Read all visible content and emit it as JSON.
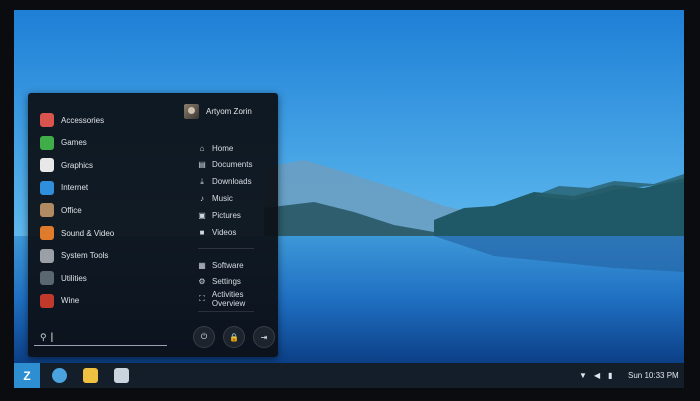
{
  "menu": {
    "categories": [
      {
        "label": "Accessories",
        "icon": "accessories-icon",
        "color": "#d9534f"
      },
      {
        "label": "Games",
        "icon": "games-icon",
        "color": "#3fae49"
      },
      {
        "label": "Graphics",
        "icon": "graphics-icon",
        "color": "#e8e8e8"
      },
      {
        "label": "Internet",
        "icon": "internet-icon",
        "color": "#2f8fdc"
      },
      {
        "label": "Office",
        "icon": "office-icon",
        "color": "#b08a62"
      },
      {
        "label": "Sound & Video",
        "icon": "sound-video-icon",
        "color": "#e07b2c"
      },
      {
        "label": "System Tools",
        "icon": "system-tools-icon",
        "color": "#9aa0a6"
      },
      {
        "label": "Utilities",
        "icon": "utilities-icon",
        "color": "#5b6770"
      },
      {
        "label": "Wine",
        "icon": "wine-icon",
        "color": "#c0392b"
      }
    ],
    "user": {
      "name": "Artyom Zorin"
    },
    "places": [
      {
        "label": "Home",
        "icon": "home-icon",
        "glyph": "⌂"
      },
      {
        "label": "Documents",
        "icon": "documents-icon",
        "glyph": "▤"
      },
      {
        "label": "Downloads",
        "icon": "downloads-icon",
        "glyph": "⤓"
      },
      {
        "label": "Music",
        "icon": "music-icon",
        "glyph": "♪"
      },
      {
        "label": "Pictures",
        "icon": "pictures-icon",
        "glyph": "▣"
      },
      {
        "label": "Videos",
        "icon": "videos-icon",
        "glyph": "■"
      }
    ],
    "system": [
      {
        "label": "Software",
        "icon": "software-icon",
        "glyph": "▦"
      },
      {
        "label": "Settings",
        "icon": "settings-icon",
        "glyph": "⚙"
      },
      {
        "label": "Activities Overview",
        "icon": "activities-icon",
        "glyph": "⛶"
      }
    ],
    "search": {
      "value": ""
    },
    "power_buttons": [
      {
        "name": "power-icon",
        "glyph": "⏻"
      },
      {
        "name": "lock-icon",
        "glyph": "🔒"
      },
      {
        "name": "logout-icon",
        "glyph": "⇥"
      }
    ]
  },
  "panel": {
    "launcher_icon": "zorin-logo-icon",
    "launcher_glyph": "Z",
    "taskbar": [
      {
        "name": "chromium-icon",
        "color": "#4aa3df"
      },
      {
        "name": "software-store-icon",
        "color": "#f0c040"
      },
      {
        "name": "files-icon",
        "color": "#c9d4dc"
      }
    ],
    "tray": {
      "wifi_glyph": "▼",
      "volume_glyph": "◀",
      "battery_glyph": "▮",
      "clock": "Sun 10:33 PM"
    },
    "accent": "#2d8fd2"
  }
}
